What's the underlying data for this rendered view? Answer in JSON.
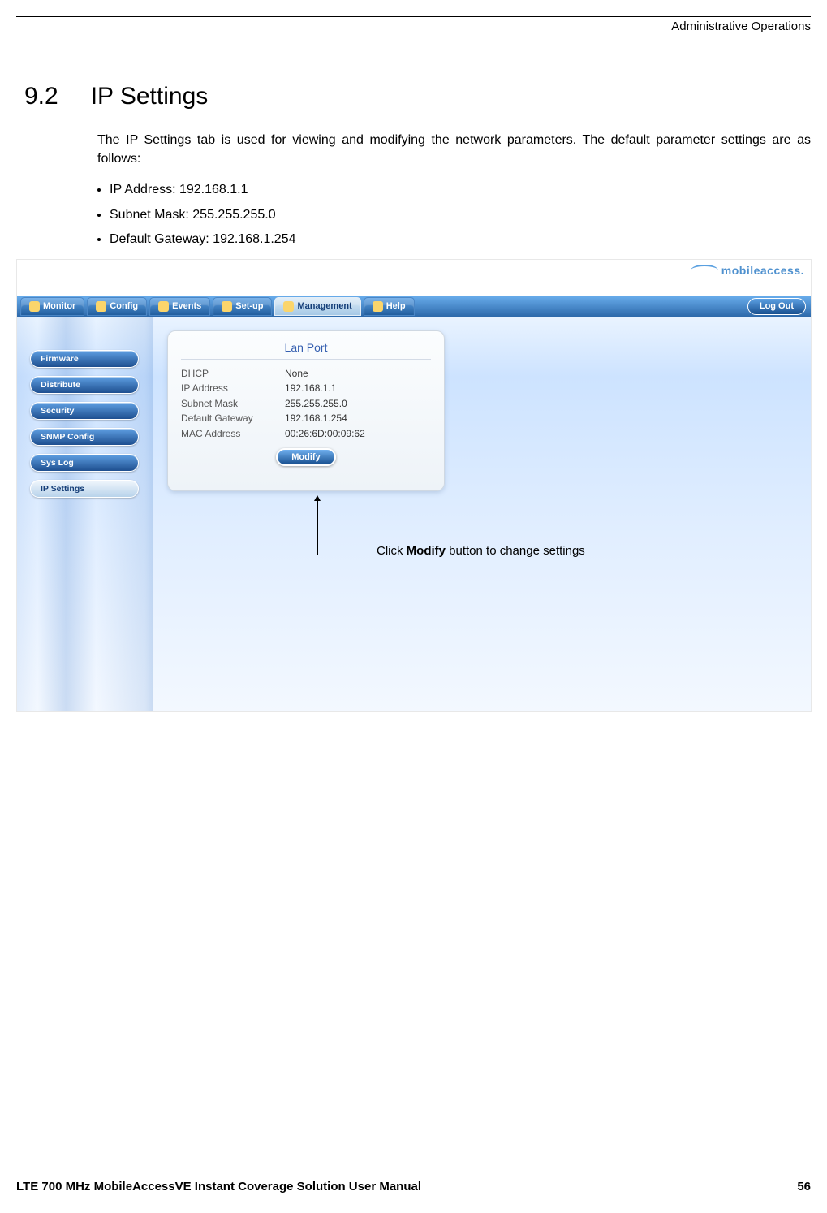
{
  "page_header": "Administrative Operations",
  "section": {
    "number": "9.2",
    "title": "IP Settings"
  },
  "paragraph": "The IP Settings tab is used for viewing and modifying the network parameters. The default parameter settings are as follows:",
  "defaults": [
    "IP Address: 192.168.1.1",
    "Subnet Mask: 255.255.255.0",
    "Default Gateway: 192.168.1.254"
  ],
  "logo_text": "mobileaccess.",
  "nav": {
    "items": [
      "Monitor",
      "Config",
      "Events",
      "Set-up",
      "Management",
      "Help"
    ],
    "active": "Management",
    "logout": "Log Out"
  },
  "sidebar": {
    "items": [
      "Firmware",
      "Distribute",
      "Security",
      "SNMP Config",
      "Sys Log",
      "IP Settings"
    ],
    "active": "IP Settings"
  },
  "panel": {
    "title": "Lan Port",
    "rows": [
      {
        "k": "DHCP",
        "v": "None"
      },
      {
        "k": "IP Address",
        "v": "192.168.1.1"
      },
      {
        "k": "Subnet Mask",
        "v": "255.255.255.0"
      },
      {
        "k": "Default Gateway",
        "v": "192.168.1.254"
      },
      {
        "k": "MAC Address",
        "v": "00:26:6D:00:09:62"
      }
    ],
    "modify_label": "Modify"
  },
  "callout": {
    "pre": "Click ",
    "bold": "Modify",
    "post": " button to change settings"
  },
  "footer": {
    "manual": "LTE 700 MHz MobileAccessVE Instant Coverage Solution User Manual",
    "page": "56"
  }
}
